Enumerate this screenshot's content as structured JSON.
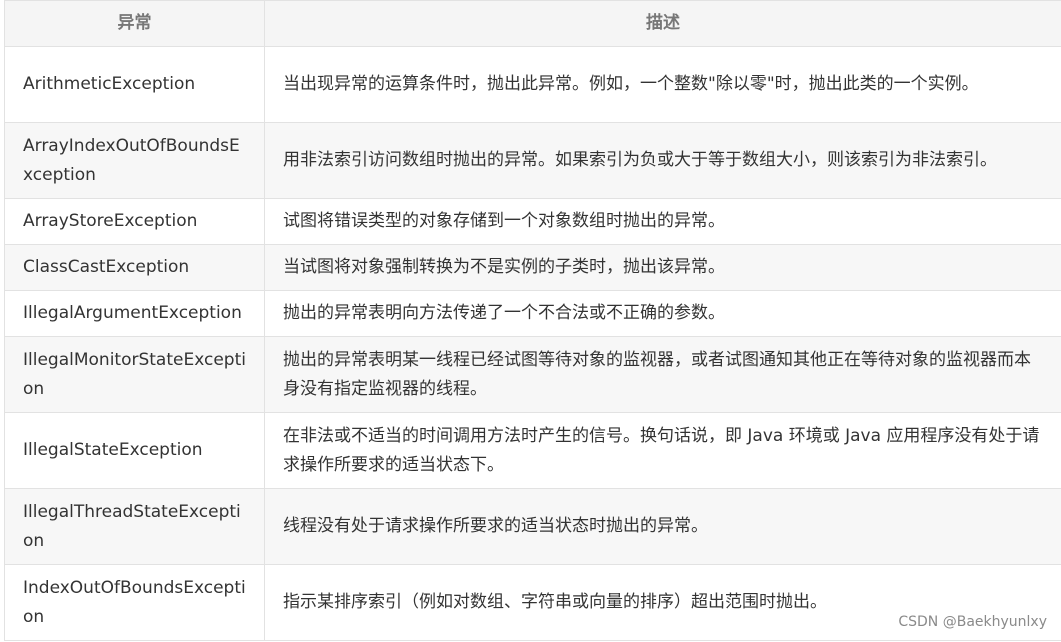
{
  "table": {
    "headers": {
      "exception": "异常",
      "description": "描述"
    },
    "rows": [
      {
        "name": "ArithmeticException",
        "desc": "当出现异常的运算条件时，抛出此异常。例如，一个整数\"除以零\"时，抛出此类的一个实例。"
      },
      {
        "name": "ArrayIndexOutOfBoundsException",
        "desc": "用非法索引访问数组时抛出的异常。如果索引为负或大于等于数组大小，则该索引为非法索引。"
      },
      {
        "name": "ArrayStoreException",
        "desc": "试图将错误类型的对象存储到一个对象数组时抛出的异常。"
      },
      {
        "name": "ClassCastException",
        "desc": "当试图将对象强制转换为不是实例的子类时，抛出该异常。"
      },
      {
        "name": "IllegalArgumentException",
        "desc": "抛出的异常表明向方法传递了一个不合法或不正确的参数。"
      },
      {
        "name": "IllegalMonitorStateException",
        "desc": "抛出的异常表明某一线程已经试图等待对象的监视器，或者试图通知其他正在等待对象的监视器而本身没有指定监视器的线程。"
      },
      {
        "name": "IllegalStateException",
        "desc": "在非法或不适当的时间调用方法时产生的信号。换句话说，即 Java 环境或 Java 应用程序没有处于请求操作所要求的适当状态下。"
      },
      {
        "name": "IllegalThreadStateException",
        "desc": "线程没有处于请求操作所要求的适当状态时抛出的异常。"
      },
      {
        "name": "IndexOutOfBoundsException",
        "desc": "指示某排序索引（例如对数组、字符串或向量的排序）超出范围时抛出。"
      }
    ]
  },
  "watermark": "CSDN @Baekhyunlxy"
}
